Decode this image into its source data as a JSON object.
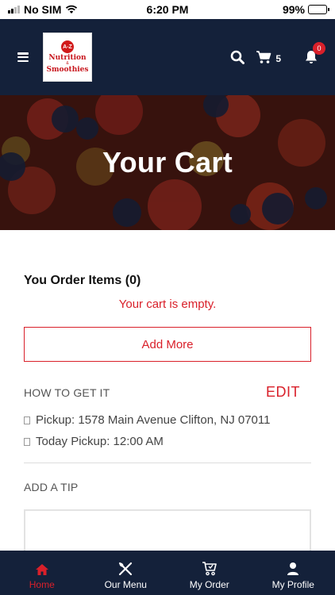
{
  "status_bar": {
    "carrier": "No SIM",
    "time": "6:20 PM",
    "battery": "99%"
  },
  "header": {
    "logo": {
      "badge": "A-Z",
      "line1": "Nutrition",
      "line2": "&",
      "line3": "Smoothies"
    },
    "cart_count": "5",
    "notification_count": "0"
  },
  "hero": {
    "title": "Your Cart"
  },
  "cart": {
    "items_title": "You Order Items (0)",
    "empty_message": "Your cart is empty.",
    "add_more_label": "Add More"
  },
  "how_to_get": {
    "title": "HOW TO GET IT",
    "edit_label": "EDIT",
    "pickup": "Pickup: 1578 Main Avenue Clifton, NJ 07011",
    "pickup_time": "Today Pickup: 12:00 AM"
  },
  "tip": {
    "title": "ADD A TIP"
  },
  "bottom_nav": {
    "items": [
      {
        "label": "Home",
        "icon": "home-icon"
      },
      {
        "label": "Our Menu",
        "icon": "utensils-icon"
      },
      {
        "label": "My Order",
        "icon": "cart-icon"
      },
      {
        "label": "My Profile",
        "icon": "user-icon"
      }
    ]
  },
  "colors": {
    "navy": "#14213a",
    "accent_red": "#d9202a"
  }
}
